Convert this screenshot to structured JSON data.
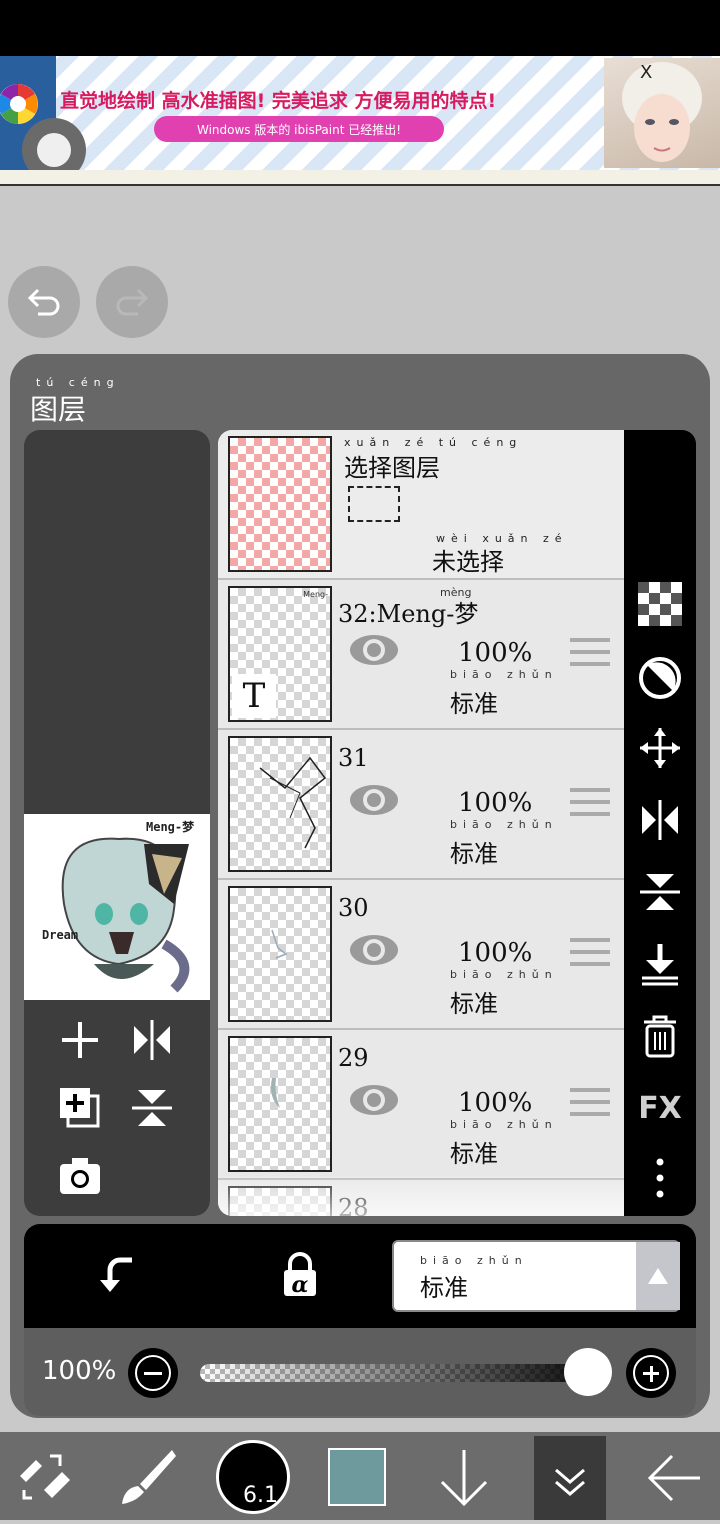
{
  "ad": {
    "headline": "直觉地绘制 高水准插图! 完美追求 方便易用的特点!",
    "subline": "Windows 版本的 ibisPaint 已经推出!",
    "close": "X"
  },
  "panel": {
    "title_pinyin": "tú céng",
    "title": "图层"
  },
  "selection_layer": {
    "title_pinyin": "xuǎn zé tú céng",
    "title": "选择图层",
    "status_pinyin": "wèi xuǎn zé",
    "status": "未选择"
  },
  "layers": [
    {
      "name": "32:Meng-梦",
      "name_pinyin": "mèng",
      "opacity": "100%",
      "blend_pinyin": "biāo zhǔn",
      "blend": "标准",
      "text_badge": "T",
      "thumb_text": "Meng-"
    },
    {
      "name": "31",
      "opacity": "100%",
      "blend_pinyin": "biāo zhǔn",
      "blend": "标准"
    },
    {
      "name": "30",
      "opacity": "100%",
      "blend_pinyin": "biāo zhǔn",
      "blend": "标准"
    },
    {
      "name": "29",
      "opacity": "100%",
      "blend_pinyin": "biāo zhǔn",
      "blend": "标准"
    },
    {
      "name": "28"
    }
  ],
  "preview": {
    "label_top": "Meng-梦",
    "label_left": "Dream"
  },
  "right_bar": {
    "fx_label": "FX"
  },
  "blend_mode": {
    "pinyin": "biāo zhǔn",
    "value": "标准"
  },
  "opacity_row": {
    "value": "100%",
    "slider_fraction": 1.0
  },
  "toolbar": {
    "brush_size": "6.1",
    "current_color": "#6e9a9e"
  }
}
